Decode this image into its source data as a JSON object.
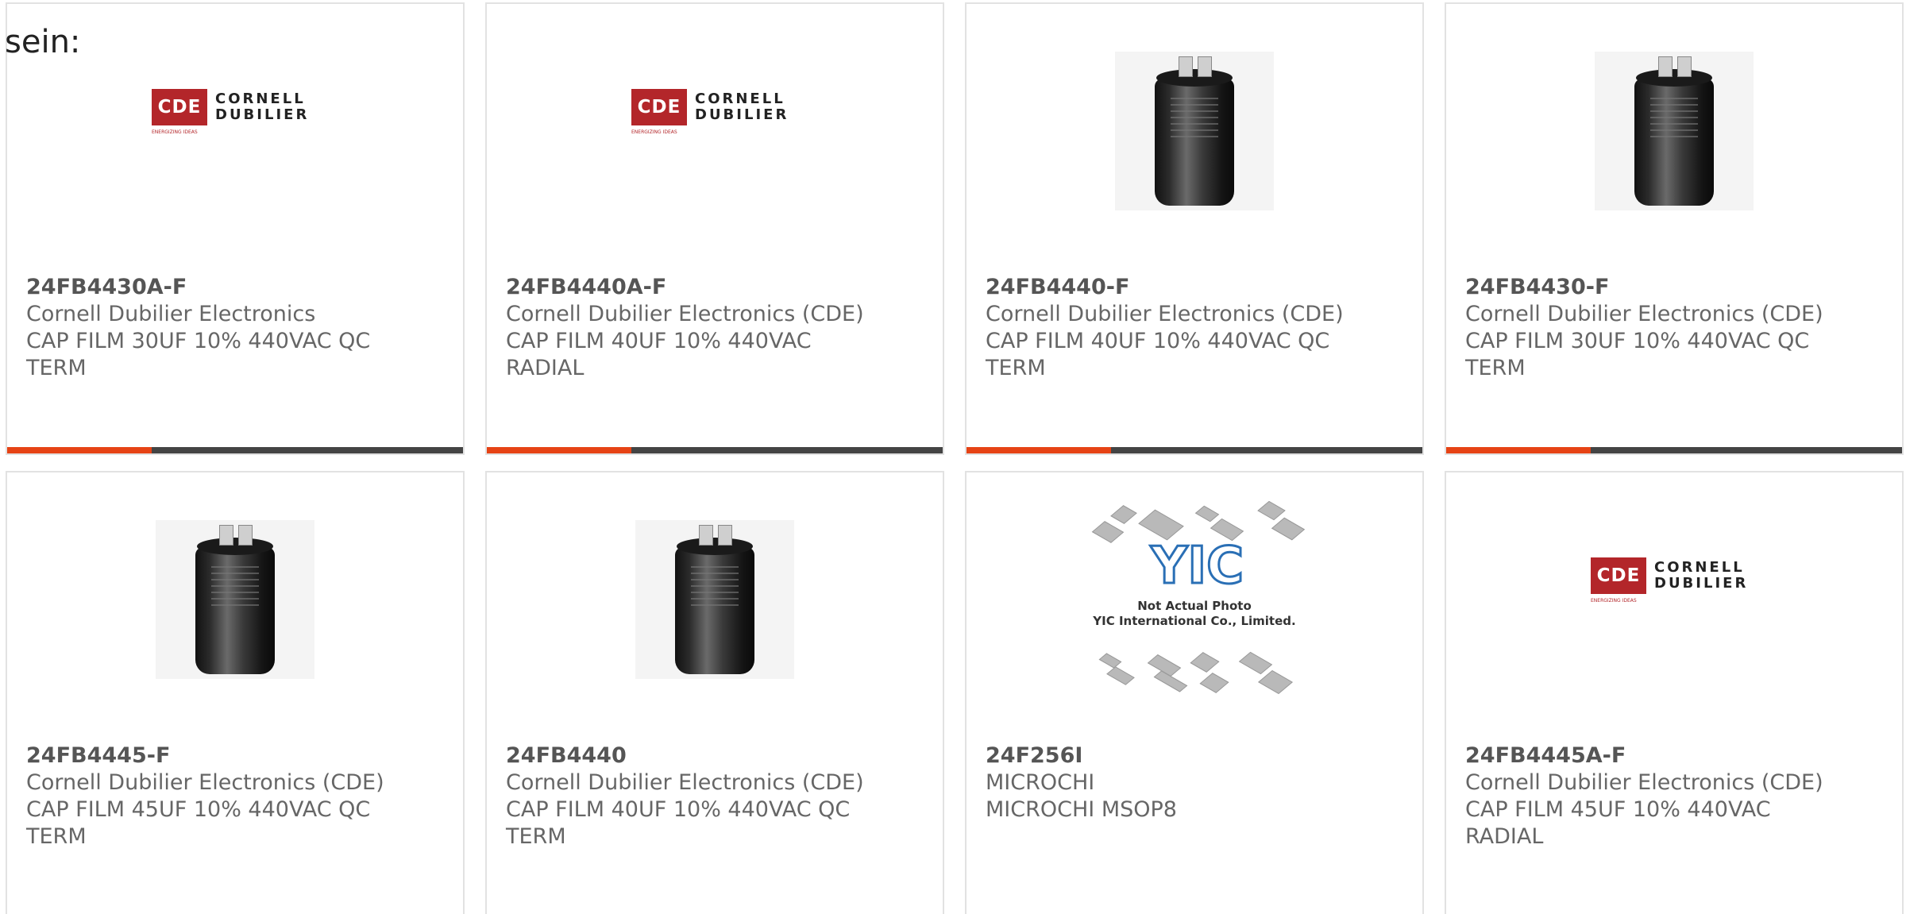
{
  "lead_text": "sein:",
  "logos": {
    "cde_mark": "CDE",
    "cde_line1": "CORNELL",
    "cde_line2": "DUBILIER",
    "cde_tagline": "ENERGIZING IDEAS"
  },
  "yic": {
    "mark": "YIC",
    "line1": "Not Actual Photo",
    "line2": "YIC International Co., Limited."
  },
  "products": [
    {
      "part": "24FB4430A-F",
      "maker": "Cornell Dubilier Electronics",
      "desc": "CAP FILM 30UF 10% 440VAC QC TERM",
      "image": "cde-logo"
    },
    {
      "part": "24FB4440A-F",
      "maker": "Cornell Dubilier Electronics (CDE)",
      "desc": "CAP FILM 40UF 10% 440VAC RADIAL",
      "image": "cde-logo"
    },
    {
      "part": "24FB4440-F",
      "maker": "Cornell Dubilier Electronics (CDE)",
      "desc": "CAP FILM 40UF 10% 440VAC QC TERM",
      "image": "capacitor-photo"
    },
    {
      "part": "24FB4430-F",
      "maker": "Cornell Dubilier Electronics (CDE)",
      "desc": "CAP FILM 30UF 10% 440VAC QC TERM",
      "image": "capacitor-photo"
    },
    {
      "part": "24FB4445-F",
      "maker": "Cornell Dubilier Electronics (CDE)",
      "desc": "CAP FILM 45UF 10% 440VAC QC TERM",
      "image": "capacitor-photo"
    },
    {
      "part": "24FB4440",
      "maker": "Cornell Dubilier Electronics (CDE)",
      "desc": "CAP FILM 40UF 10% 440VAC QC TERM",
      "image": "capacitor-photo"
    },
    {
      "part": "24F256I",
      "maker": "MICROCHI",
      "desc": "MICROCHI MSOP8",
      "image": "yic-placeholder"
    },
    {
      "part": "24FB4445A-F",
      "maker": "Cornell Dubilier Electronics (CDE)",
      "desc": "CAP FILM 45UF 10% 440VAC RADIAL",
      "image": "cde-logo"
    }
  ],
  "colors": {
    "accent": "#e64315",
    "bar": "#444444",
    "text": "#666666",
    "border": "#e2e2e2",
    "cde_red": "#b3262a",
    "yic_blue": "#2a6fb5"
  }
}
